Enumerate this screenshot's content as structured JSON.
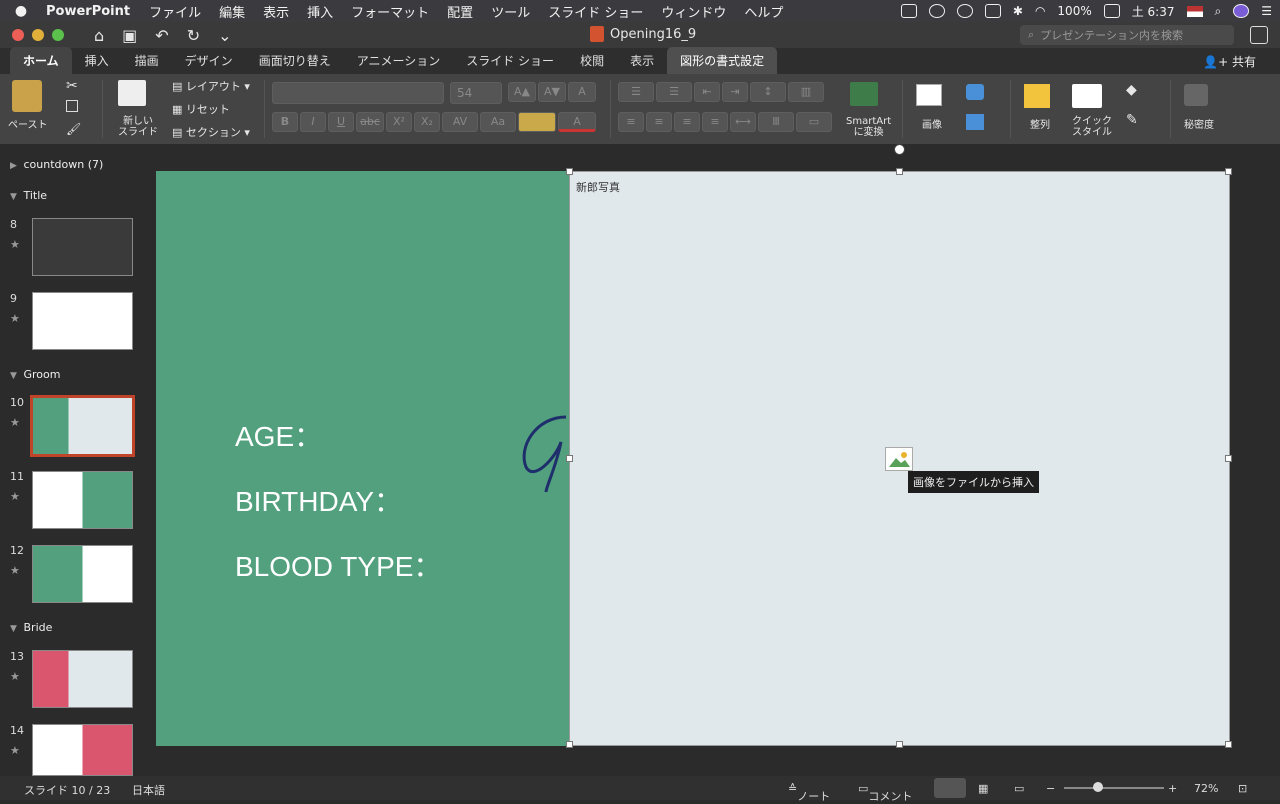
{
  "menubar": {
    "app_name": "PowerPoint",
    "menus": [
      "ファイル",
      "編集",
      "表示",
      "挿入",
      "フォーマット",
      "配置",
      "ツール",
      "スライド ショー",
      "ウィンドウ",
      "ヘルプ"
    ],
    "battery": "100%",
    "clock": "土 6:37"
  },
  "window": {
    "title": "Opening16_9",
    "search_placeholder": "プレゼンテーション内を検索"
  },
  "tabs": [
    "ホーム",
    "挿入",
    "描画",
    "デザイン",
    "画面切り替え",
    "アニメーション",
    "スライド ショー",
    "校閲",
    "表示",
    "図形の書式設定"
  ],
  "active_tab": "ホーム",
  "share_label": "共有",
  "ribbon": {
    "paste": "ペースト",
    "new_slide": "新しい\nスライド",
    "layout": "レイアウト",
    "reset": "リセット",
    "section": "セクション",
    "font_size": "54",
    "smartart": "SmartArt\nに変換",
    "picture": "画像",
    "arrange": "整列",
    "quick_styles": "クイック\nスタイル",
    "sensitivity": "秘密度"
  },
  "sidebar": {
    "sections": [
      "countdown (7)",
      "Title",
      "Groom",
      "Bride"
    ],
    "slides": [
      {
        "num": "8",
        "style": "dark"
      },
      {
        "num": "9",
        "style": "white"
      },
      {
        "num": "10",
        "style": "groom-selected"
      },
      {
        "num": "11",
        "style": "white-green"
      },
      {
        "num": "12",
        "style": "green-white"
      },
      {
        "num": "13",
        "style": "bride"
      },
      {
        "num": "14",
        "style": "white-pink"
      }
    ]
  },
  "slide": {
    "lines": [
      "AGE：",
      "BIRTHDAY：",
      "BLOOD TYPE："
    ],
    "placeholder_label": "新郎写真",
    "tooltip": "画像をファイルから挿入",
    "panel_color": "#52a07e",
    "photo_color": "#e1e8ec"
  },
  "status": {
    "slide_counter": "スライド 10 / 23",
    "language": "日本語",
    "notes": "ノート",
    "comments": "コメント",
    "zoom": "72%"
  }
}
